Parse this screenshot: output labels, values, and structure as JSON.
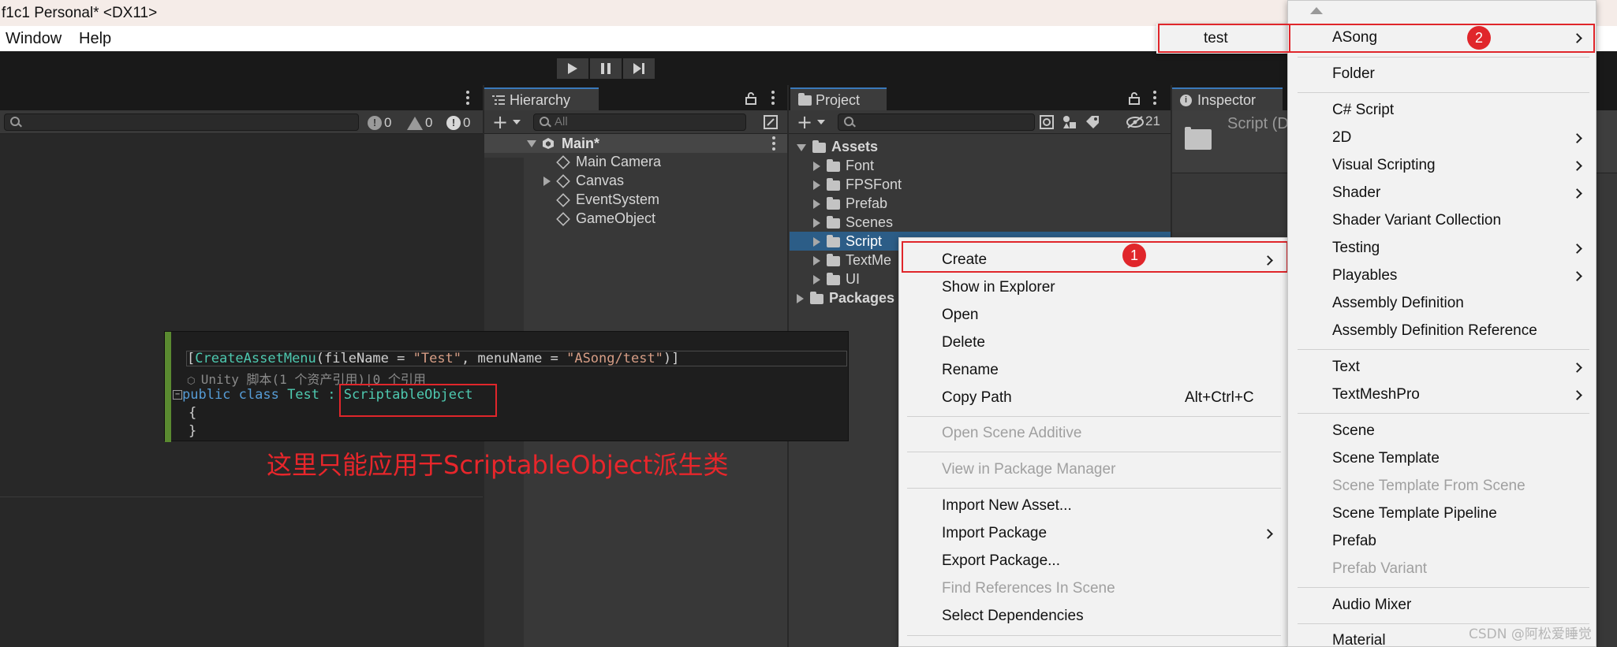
{
  "window": {
    "title": "f1c1 Personal* <DX11>",
    "menu": [
      "Window",
      "Help"
    ]
  },
  "console": {
    "counts": {
      "info": "0",
      "warn": "0",
      "error": "0"
    }
  },
  "hierarchy": {
    "tab": "Hierarchy",
    "search_placeholder": "All",
    "scene": "Main*",
    "items": [
      "Main Camera",
      "Canvas",
      "EventSystem",
      "GameObject"
    ]
  },
  "project": {
    "tab": "Project",
    "hidden_count": "21",
    "root": "Assets",
    "folders": [
      "Font",
      "FPSFont",
      "Prefab",
      "Scenes",
      "Script",
      "TextMe",
      "UI"
    ],
    "packages": "Packages"
  },
  "inspector": {
    "tab": "Inspector",
    "selected": "Script (D"
  },
  "code": {
    "line1_attr": "CreateAssetMenu",
    "line1_rest_a": "(fileName = ",
    "line1_str1": "\"Test\"",
    "line1_rest_b": ", menuName = ",
    "line1_str2": "\"ASong/test\"",
    "line1_close": ")]",
    "line1_open": "[",
    "line2": "Unity 脚本(1 个资产引用)|0 个引用",
    "line3_kw": "public class",
    "line3_name": " Test :",
    "line3_base": "ScriptableObject",
    "line4": "{",
    "line5": "}"
  },
  "annotation": "这里只能应用于ScriptableObject派生类",
  "watermark": "CSDN @阿松爱睡觉",
  "context_menu": {
    "items": [
      {
        "label": "Create",
        "submenu": true
      },
      {
        "label": "Show in Explorer"
      },
      {
        "label": "Open"
      },
      {
        "label": "Delete"
      },
      {
        "label": "Rename"
      },
      {
        "label": "Copy Path",
        "shortcut": "Alt+Ctrl+C"
      },
      {
        "label": "Open Scene Additive",
        "disabled": true
      },
      {
        "label": "View in Package Manager",
        "disabled": true
      },
      {
        "label": "Import New Asset..."
      },
      {
        "label": "Import Package",
        "submenu": true
      },
      {
        "label": "Export Package..."
      },
      {
        "label": "Find References In Scene",
        "disabled": true
      },
      {
        "label": "Select Dependencies"
      }
    ],
    "badge": "1"
  },
  "create_menu": {
    "items": [
      {
        "label": "ASong",
        "submenu": true
      },
      {
        "label": "Folder"
      },
      {
        "label": "C# Script"
      },
      {
        "label": "2D",
        "submenu": true
      },
      {
        "label": "Visual Scripting",
        "submenu": true
      },
      {
        "label": "Shader",
        "submenu": true
      },
      {
        "label": "Shader Variant Collection"
      },
      {
        "label": "Testing",
        "submenu": true
      },
      {
        "label": "Playables",
        "submenu": true
      },
      {
        "label": "Assembly Definition"
      },
      {
        "label": "Assembly Definition Reference"
      },
      {
        "label": "Text",
        "submenu": true
      },
      {
        "label": "TextMeshPro",
        "submenu": true
      },
      {
        "label": "Scene"
      },
      {
        "label": "Scene Template"
      },
      {
        "label": "Scene Template From Scene",
        "disabled": true
      },
      {
        "label": "Scene Template Pipeline"
      },
      {
        "label": "Prefab"
      },
      {
        "label": "Prefab Variant",
        "disabled": true
      },
      {
        "label": "Audio Mixer"
      },
      {
        "label": "Material"
      }
    ],
    "badge": "2"
  },
  "asong_menu": {
    "items": [
      "test"
    ]
  },
  "colors": {
    "highlight_red": "#e0262b",
    "selection_blue": "#2c5d87",
    "annotation_red": "#e8262b"
  }
}
